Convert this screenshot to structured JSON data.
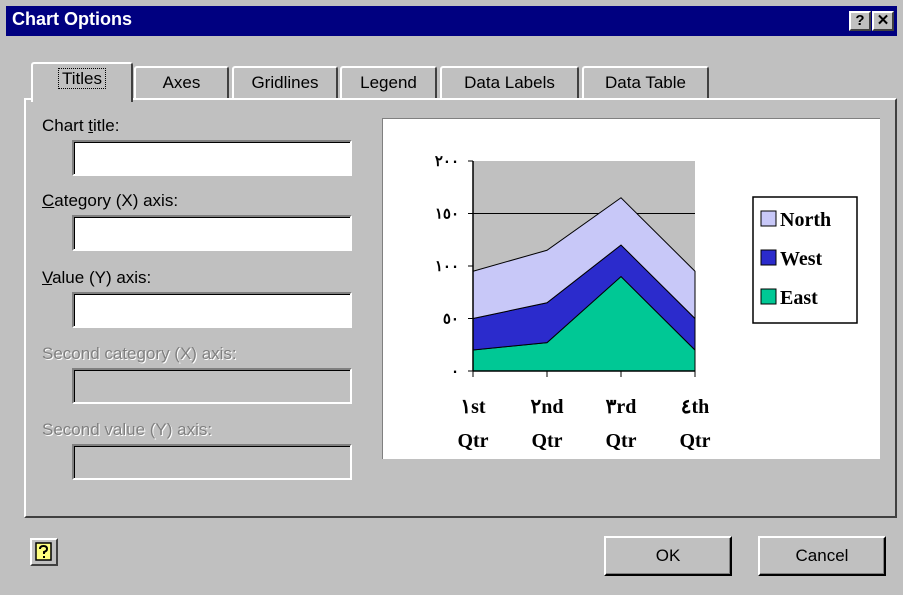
{
  "window": {
    "title": "Chart Options",
    "help_button": "?",
    "close_button": "✕"
  },
  "tabs": [
    "Titles",
    "Axes",
    "Gridlines",
    "Legend",
    "Data Labels",
    "Data Table"
  ],
  "fields": {
    "chart_title": {
      "label_pre": "Chart ",
      "label_u": "t",
      "label_post": "itle:",
      "value": ""
    },
    "category_x": {
      "label_pre": "",
      "label_u": "C",
      "label_post": "ategory (X) axis:",
      "value": ""
    },
    "value_y": {
      "label_pre": "",
      "label_u": "V",
      "label_post": "alue (Y) axis:",
      "value": ""
    },
    "second_category_x": {
      "label": "Second category (X) axis:",
      "value": ""
    },
    "second_value_y": {
      "label": "Second value (Y) axis:",
      "value": ""
    }
  },
  "buttons": {
    "ok": "OK",
    "cancel": "Cancel"
  },
  "chart_data": {
    "type": "area",
    "stacked": true,
    "categories": [
      [
        "١st",
        "Qtr"
      ],
      [
        "٢nd",
        "Qtr"
      ],
      [
        "٣rd",
        "Qtr"
      ],
      [
        "٤th",
        "Qtr"
      ]
    ],
    "y_ticks": [
      "٠",
      "٥٠",
      "١٠٠",
      "١٥٠",
      "٢٠٠"
    ],
    "ylim": [
      0,
      200
    ],
    "gridlines": [
      150
    ],
    "series": [
      {
        "name": "East",
        "values": [
          20,
          27,
          90,
          20
        ],
        "color": "#00c895"
      },
      {
        "name": "West",
        "values": [
          30,
          38,
          30,
          30
        ],
        "color": "#2b2bcc"
      },
      {
        "name": "North",
        "values": [
          45,
          50,
          45,
          45
        ],
        "color": "#c8c8f8"
      }
    ],
    "legend_order": [
      "North",
      "West",
      "East"
    ],
    "legend_position": "right",
    "plot_background": "#c0c0c0"
  }
}
